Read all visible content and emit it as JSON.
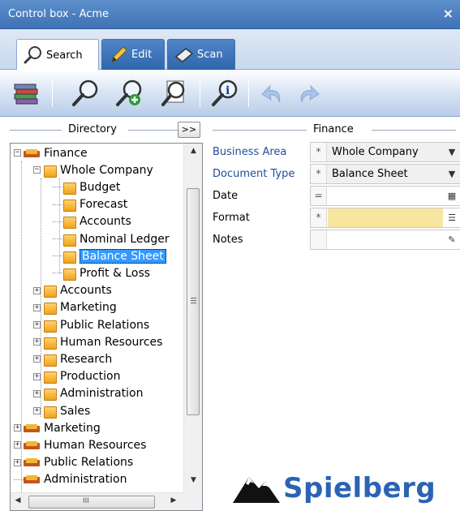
{
  "window": {
    "title": "Control box - Acme",
    "close_glyph": "×"
  },
  "tabs": [
    {
      "label": "Search",
      "icon": "magnifier-icon",
      "active": true
    },
    {
      "label": "Edit",
      "icon": "pencil-icon",
      "active": false
    },
    {
      "label": "Scan",
      "icon": "scanner-icon",
      "active": false
    }
  ],
  "toolbar": {
    "buttons": [
      "books-icon",
      "search-icon",
      "search-add-icon",
      "search-document-icon",
      "search-info-icon",
      "undo-icon",
      "redo-icon"
    ]
  },
  "directory": {
    "header": "Directory",
    "expand_label": ">>",
    "tree": [
      {
        "label": "Finance",
        "level": 0,
        "exp": "−",
        "type": "big"
      },
      {
        "label": "Whole Company",
        "level": 1,
        "exp": "−",
        "type": "sm"
      },
      {
        "label": "Budget",
        "level": 2,
        "type": "sm"
      },
      {
        "label": "Forecast",
        "level": 2,
        "type": "sm"
      },
      {
        "label": "Accounts",
        "level": 2,
        "type": "sm"
      },
      {
        "label": "Nominal Ledger",
        "level": 2,
        "type": "sm"
      },
      {
        "label": "Balance Sheet",
        "level": 2,
        "type": "sm",
        "selected": true
      },
      {
        "label": "Profit & Loss",
        "level": 2,
        "type": "sm"
      },
      {
        "label": "Accounts",
        "level": 1,
        "exp": "+",
        "type": "sm"
      },
      {
        "label": "Marketing",
        "level": 1,
        "exp": "+",
        "type": "sm"
      },
      {
        "label": "Public Relations",
        "level": 1,
        "exp": "+",
        "type": "sm"
      },
      {
        "label": "Human Resources",
        "level": 1,
        "exp": "+",
        "type": "sm"
      },
      {
        "label": "Research",
        "level": 1,
        "exp": "+",
        "type": "sm"
      },
      {
        "label": "Production",
        "level": 1,
        "exp": "+",
        "type": "sm"
      },
      {
        "label": "Administration",
        "level": 1,
        "exp": "+",
        "type": "sm"
      },
      {
        "label": "Sales",
        "level": 1,
        "exp": "+",
        "type": "sm"
      },
      {
        "label": "Marketing",
        "level": 0,
        "exp": "+",
        "type": "big"
      },
      {
        "label": "Human Resources",
        "level": 0,
        "exp": "+",
        "type": "big"
      },
      {
        "label": "Public Relations",
        "level": 0,
        "exp": "+",
        "type": "big"
      },
      {
        "label": "Administration",
        "level": 0,
        "type": "big"
      }
    ],
    "scroll": {
      "up": "▲",
      "down": "▼",
      "left": "◀",
      "right": "▶",
      "hgrip": "III"
    }
  },
  "form": {
    "header": "Finance",
    "fields": [
      {
        "label": "Business Area",
        "prefix": "*",
        "value": "Whole Company",
        "button": "▼",
        "blue": true
      },
      {
        "label": "Document Type",
        "prefix": "*",
        "value": "Balance Sheet",
        "button": "▼",
        "blue": true
      },
      {
        "label": "Date",
        "prefix": "=",
        "value": "",
        "button": "▦",
        "blue": false
      },
      {
        "label": "Format",
        "prefix": "*",
        "value": "",
        "button": "☰",
        "blue": false,
        "highlight": true
      },
      {
        "label": "Notes",
        "prefix": "",
        "value": "",
        "button": "✎",
        "blue": false
      }
    ]
  },
  "logo": {
    "text": "Spielberg"
  },
  "colors": {
    "accent": "#3f72b5",
    "selection": "#3399ff",
    "format_highlight": "#f8e6a0",
    "logo": "#2b63b4"
  }
}
